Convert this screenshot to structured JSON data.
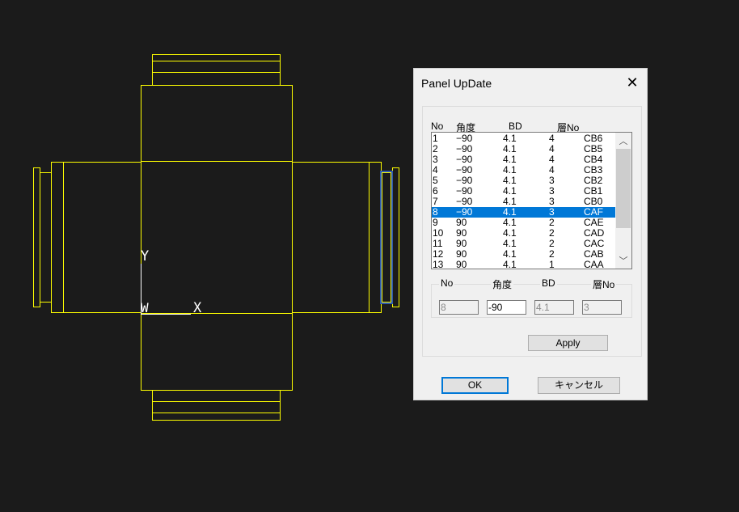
{
  "canvas": {
    "labels": {
      "y_axis": "Y",
      "x_axis": "X",
      "origin": "W"
    },
    "line_color": "#ffff00",
    "highlight_color": "#2f5bb0"
  },
  "dialog": {
    "title": "Panel UpDate",
    "close_icon": "close-icon",
    "list": {
      "headers": [
        "No",
        "角度",
        "BD",
        "層No"
      ],
      "rows": [
        [
          "1",
          "−90",
          "4.1",
          "4",
          "CB6"
        ],
        [
          "2",
          "−90",
          "4.1",
          "4",
          "CB5"
        ],
        [
          "3",
          "−90",
          "4.1",
          "4",
          "CB4"
        ],
        [
          "4",
          "−90",
          "4.1",
          "4",
          "CB3"
        ],
        [
          "5",
          "−90",
          "4.1",
          "3",
          "CB2"
        ],
        [
          "6",
          "−90",
          "4.1",
          "3",
          "CB1"
        ],
        [
          "7",
          "−90",
          "4.1",
          "3",
          "CB0"
        ],
        [
          "8",
          "−90",
          "4.1",
          "3",
          "CAF"
        ],
        [
          "9",
          "90",
          "4.1",
          "2",
          "CAE"
        ],
        [
          "10",
          "90",
          "4.1",
          "2",
          "CAD"
        ],
        [
          "11",
          "90",
          "4.1",
          "2",
          "CAC"
        ],
        [
          "12",
          "90",
          "4.1",
          "2",
          "CAB"
        ],
        [
          "13",
          "90",
          "4.1",
          "1",
          "CAA"
        ]
      ],
      "selected_index": 7
    },
    "edit": {
      "labels": [
        "No",
        "角度",
        "BD",
        "層No"
      ],
      "values": [
        "8",
        "-90",
        "4.1",
        "3"
      ]
    },
    "apply_label": "Apply",
    "ok_label": "OK",
    "cancel_label": "キャンセル",
    "accent": "#0078d7"
  }
}
